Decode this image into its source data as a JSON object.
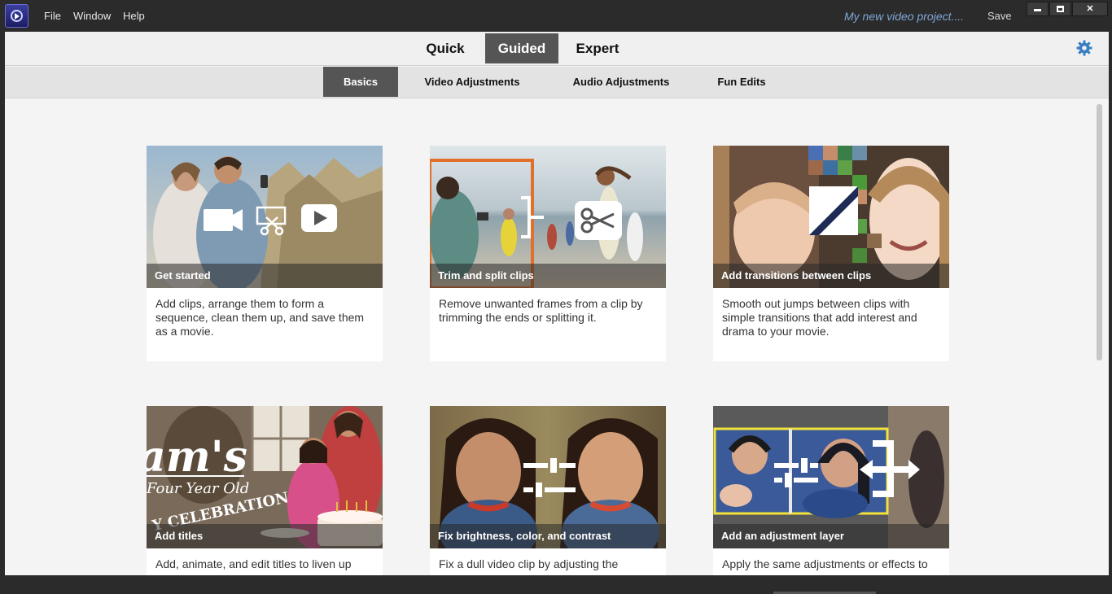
{
  "titlebar": {
    "menus": [
      "File",
      "Window",
      "Help"
    ],
    "project_name": "My new video project....",
    "save_label": "Save"
  },
  "modes": {
    "tabs": [
      "Quick",
      "Guided",
      "Expert"
    ],
    "active": "Guided"
  },
  "subtabs": {
    "items": [
      "Basics",
      "Video Adjustments",
      "Audio Adjustments",
      "Fun Edits"
    ],
    "active": "Basics"
  },
  "cards": [
    {
      "title": "Get started",
      "description": "Add clips, arrange them to form a sequence, clean them up, and save them as a movie.",
      "icon": "video-camera-film-scissors-play-icon"
    },
    {
      "title": "Trim and split clips",
      "description": "Remove unwanted frames from a clip by trimming the ends or splitting it.",
      "icon": "scissors-icon"
    },
    {
      "title": "Add transitions between clips",
      "description": "Smooth out jumps between clips with simple transitions that add interest and drama to your movie.",
      "icon": "transition-icon"
    },
    {
      "title": "Add titles",
      "description": "Add, animate, and edit titles to liven up",
      "icon": "title-text-icon"
    },
    {
      "title": "Fix brightness, color, and contrast",
      "description": "Fix a dull video clip by adjusting the",
      "icon": "sliders-icon"
    },
    {
      "title": "Add an adjustment layer",
      "description": "Apply the same adjustments or effects to",
      "icon": "adjustment-layer-icon"
    }
  ],
  "colors": {
    "accent": "#555555",
    "titlebar": "#2b2b2b",
    "project_name": "#7fa7d6",
    "gear": "#3a7fc3"
  }
}
